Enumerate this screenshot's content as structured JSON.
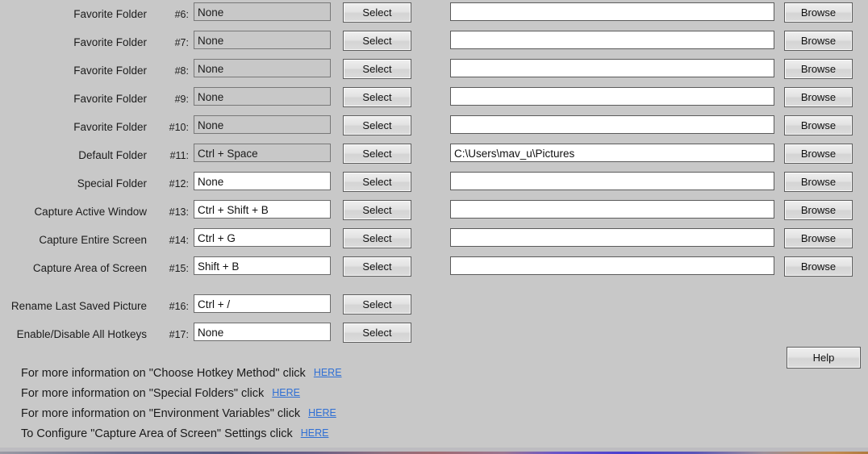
{
  "rows": [
    {
      "label": "Favorite Folder",
      "num": "#6:",
      "hotkey": "None",
      "hotkey_disabled": true,
      "path": "",
      "select_label": "Select",
      "browse_label": "Browse",
      "has_path": true
    },
    {
      "label": "Favorite Folder",
      "num": "#7:",
      "hotkey": "None",
      "hotkey_disabled": true,
      "path": "",
      "select_label": "Select",
      "browse_label": "Browse",
      "has_path": true
    },
    {
      "label": "Favorite Folder",
      "num": "#8:",
      "hotkey": "None",
      "hotkey_disabled": true,
      "path": "",
      "select_label": "Select",
      "browse_label": "Browse",
      "has_path": true
    },
    {
      "label": "Favorite Folder",
      "num": "#9:",
      "hotkey": "None",
      "hotkey_disabled": true,
      "path": "",
      "select_label": "Select",
      "browse_label": "Browse",
      "has_path": true
    },
    {
      "label": "Favorite Folder",
      "num": "#10:",
      "hotkey": "None",
      "hotkey_disabled": true,
      "path": "",
      "select_label": "Select",
      "browse_label": "Browse",
      "has_path": true
    },
    {
      "label": "Default Folder",
      "num": "#11:",
      "hotkey": "Ctrl + Space",
      "hotkey_disabled": true,
      "path": "C:\\Users\\mav_u\\Pictures",
      "select_label": "Select",
      "browse_label": "Browse",
      "has_path": true
    },
    {
      "label": "Special Folder",
      "num": "#12:",
      "hotkey": "None",
      "hotkey_disabled": false,
      "path": "",
      "select_label": "Select",
      "browse_label": "Browse",
      "has_path": true
    },
    {
      "label": "Capture Active Window",
      "num": "#13:",
      "hotkey": "Ctrl + Shift + B",
      "hotkey_disabled": false,
      "path": "",
      "select_label": "Select",
      "browse_label": "Browse",
      "has_path": true
    },
    {
      "label": "Capture Entire Screen",
      "num": "#14:",
      "hotkey": "Ctrl + G",
      "hotkey_disabled": false,
      "path": "",
      "select_label": "Select",
      "browse_label": "Browse",
      "has_path": true
    },
    {
      "label": "Capture Area of Screen",
      "num": "#15:",
      "hotkey": "Shift + B",
      "hotkey_disabled": false,
      "path": "",
      "select_label": "Select",
      "browse_label": "Browse",
      "has_path": true
    },
    {
      "label": "Rename Last Saved Picture",
      "num": "#16:",
      "hotkey": "Ctrl + /",
      "hotkey_disabled": false,
      "path": null,
      "select_label": "Select",
      "browse_label": null,
      "has_path": false
    },
    {
      "label": "Enable/Disable All Hotkeys",
      "num": "#17:",
      "hotkey": "None",
      "hotkey_disabled": false,
      "path": null,
      "select_label": "Select",
      "browse_label": null,
      "has_path": false
    }
  ],
  "help_button": {
    "label": "Help"
  },
  "info_lines": [
    {
      "text": "For more information on \"Choose Hotkey Method\" click",
      "link": "HERE"
    },
    {
      "text": "For more information on \"Special Folders\" click",
      "link": "HERE"
    },
    {
      "text": "For more information on \"Environment Variables\" click",
      "link": "HERE"
    },
    {
      "text": "To Configure \"Capture Area of Screen\" Settings click",
      "link": "HERE"
    }
  ],
  "colors": {
    "background": "#c8c8c8",
    "link": "#2f6fd4",
    "field_disabled": "#c8c8c8",
    "field_enabled": "#ffffff"
  }
}
